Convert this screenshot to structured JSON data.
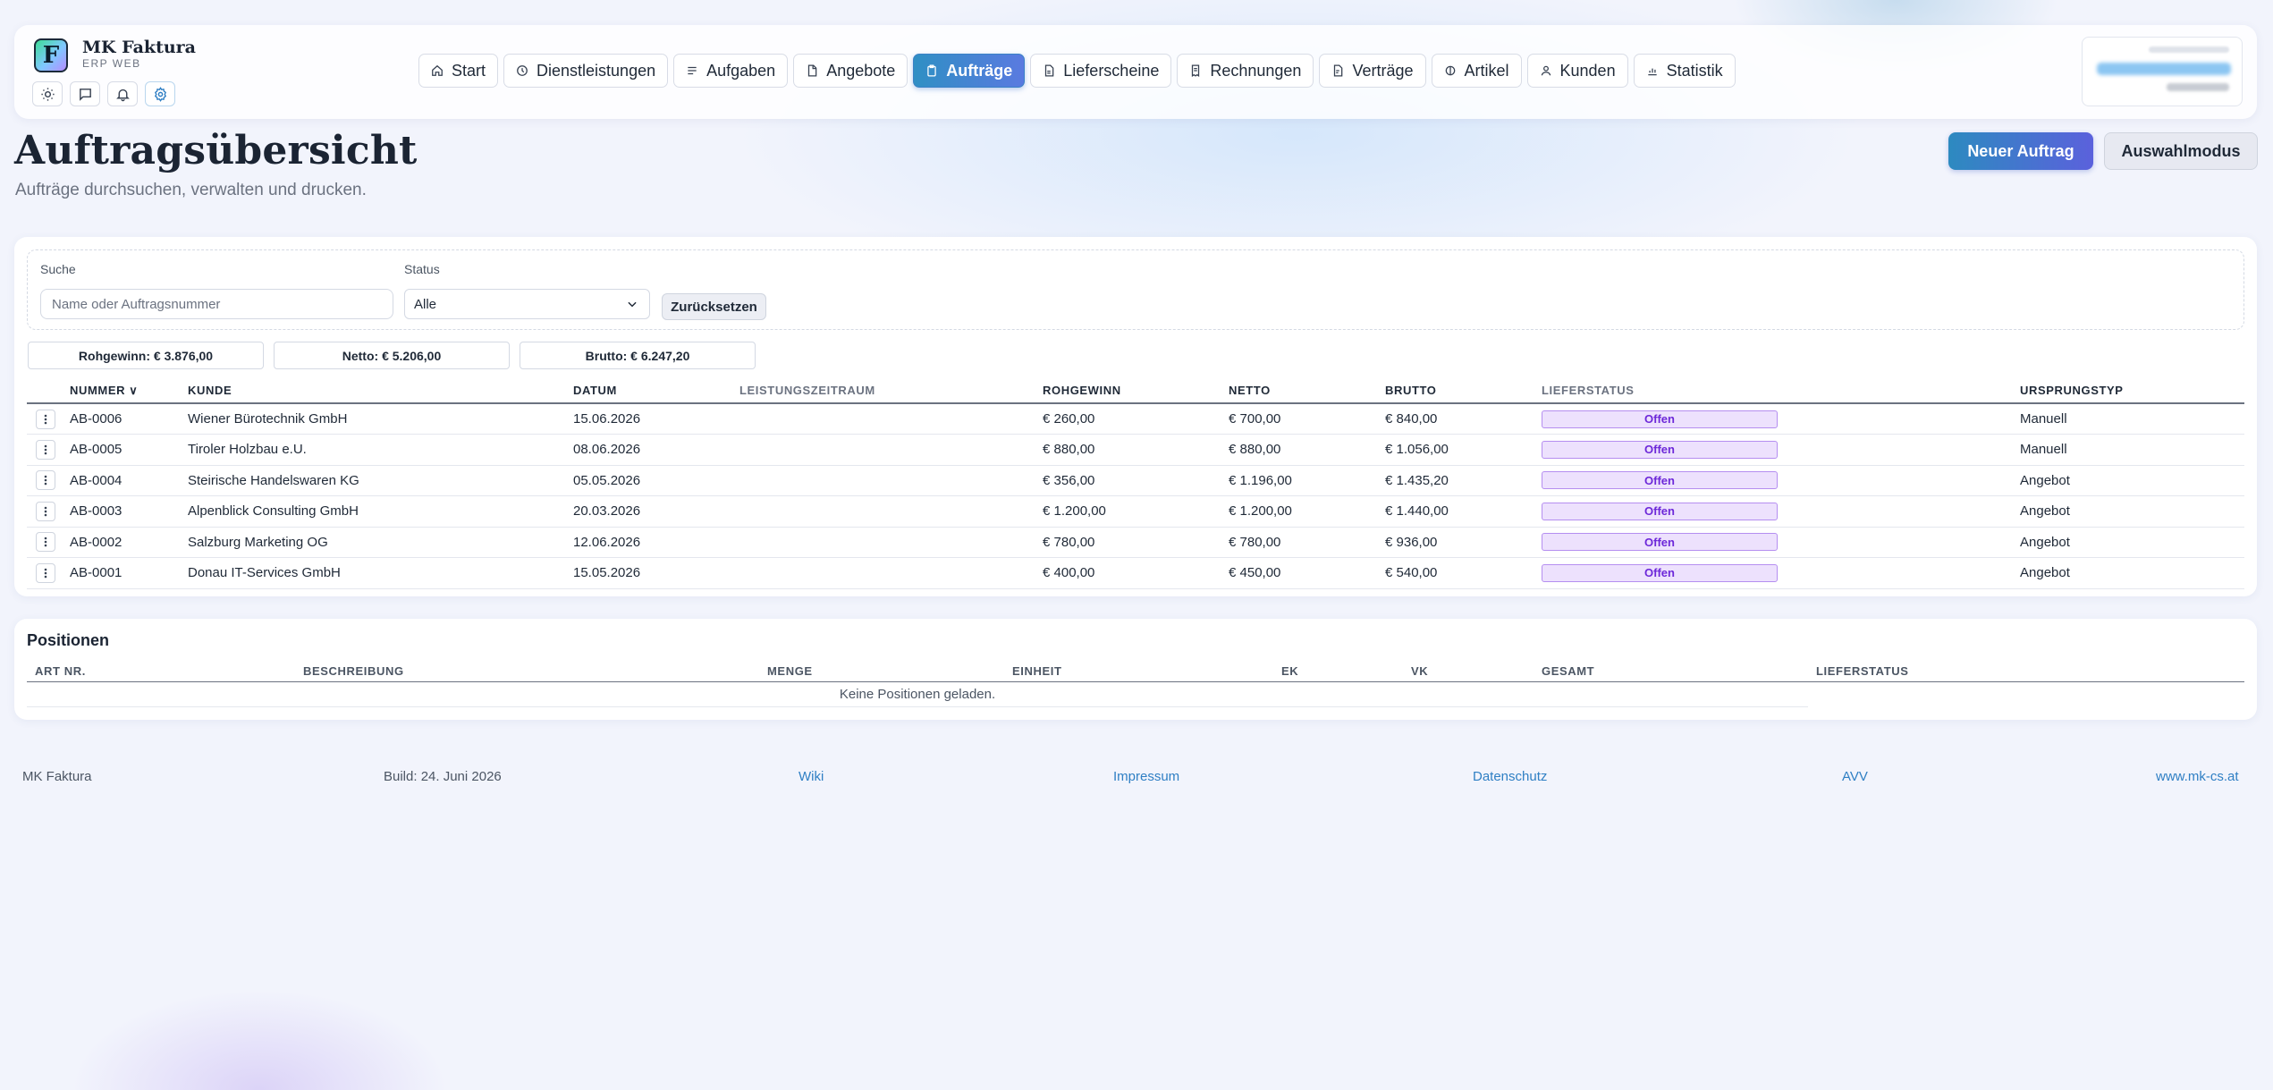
{
  "brand": {
    "logo_letter": "F",
    "name": "MK Faktura",
    "subtitle": "ERP WEB"
  },
  "utility_icons": [
    "sun-icon",
    "chat-icon",
    "bell-icon",
    "gear-icon"
  ],
  "nav": [
    {
      "label": "Start",
      "icon": "home-icon",
      "active": false
    },
    {
      "label": "Dienstleistungen",
      "icon": "clock-icon",
      "active": false
    },
    {
      "label": "Aufgaben",
      "icon": "list-icon",
      "active": false
    },
    {
      "label": "Angebote",
      "icon": "document-icon",
      "active": false
    },
    {
      "label": "Aufträge",
      "icon": "clipboard-icon",
      "active": true
    },
    {
      "label": "Lieferscheine",
      "icon": "document-icon",
      "active": false
    },
    {
      "label": "Rechnungen",
      "icon": "receipt-icon",
      "active": false
    },
    {
      "label": "Verträge",
      "icon": "document-icon",
      "active": false
    },
    {
      "label": "Artikel",
      "icon": "box-icon",
      "active": false
    },
    {
      "label": "Kunden",
      "icon": "user-icon",
      "active": false
    },
    {
      "label": "Statistik",
      "icon": "chart-icon",
      "active": false
    }
  ],
  "page": {
    "title": "Auftragsübersicht",
    "subtitle": "Aufträge durchsuchen, verwalten und drucken.",
    "new_button": "Neuer Auftrag",
    "select_button": "Auswahlmodus"
  },
  "filters": {
    "search_label": "Suche",
    "search_placeholder": "Name oder Auftragsnummer",
    "search_value": "",
    "status_label": "Status",
    "status_value": "Alle",
    "reset_button": "Zurücksetzen"
  },
  "summary": {
    "rohgewinn": "Rohgewinn: € 3.876,00",
    "netto": "Netto: € 5.206,00",
    "brutto": "Brutto: € 6.247,20"
  },
  "orders_table": {
    "columns": [
      "NUMMER ∨",
      "KUNDE",
      "DATUM",
      "LEISTUNGSZEITRAUM",
      "ROHGEWINN",
      "NETTO",
      "BRUTTO",
      "LIEFERSTATUS",
      "URSPRUNGSTYP"
    ],
    "rows": [
      {
        "nummer": "AB-0006",
        "kunde": "Wiener Bürotechnik GmbH",
        "datum": "15.06.2026",
        "zeitraum": "",
        "rohgewinn": "€ 260,00",
        "netto": "€ 700,00",
        "brutto": "€ 840,00",
        "status": "Offen",
        "typ": "Manuell"
      },
      {
        "nummer": "AB-0005",
        "kunde": "Tiroler Holzbau e.U.",
        "datum": "08.06.2026",
        "zeitraum": "",
        "rohgewinn": "€ 880,00",
        "netto": "€ 880,00",
        "brutto": "€ 1.056,00",
        "status": "Offen",
        "typ": "Manuell"
      },
      {
        "nummer": "AB-0004",
        "kunde": "Steirische Handelswaren KG",
        "datum": "05.05.2026",
        "zeitraum": "",
        "rohgewinn": "€ 356,00",
        "netto": "€ 1.196,00",
        "brutto": "€ 1.435,20",
        "status": "Offen",
        "typ": "Angebot"
      },
      {
        "nummer": "AB-0003",
        "kunde": "Alpenblick Consulting GmbH",
        "datum": "20.03.2026",
        "zeitraum": "",
        "rohgewinn": "€ 1.200,00",
        "netto": "€ 1.200,00",
        "brutto": "€ 1.440,00",
        "status": "Offen",
        "typ": "Angebot"
      },
      {
        "nummer": "AB-0002",
        "kunde": "Salzburg Marketing OG",
        "datum": "12.06.2026",
        "zeitraum": "",
        "rohgewinn": "€ 780,00",
        "netto": "€ 780,00",
        "brutto": "€ 936,00",
        "status": "Offen",
        "typ": "Angebot"
      },
      {
        "nummer": "AB-0001",
        "kunde": "Donau IT-Services GmbH",
        "datum": "15.05.2026",
        "zeitraum": "",
        "rohgewinn": "€ 400,00",
        "netto": "€ 450,00",
        "brutto": "€ 540,00",
        "status": "Offen",
        "typ": "Angebot"
      }
    ]
  },
  "positions": {
    "title": "Positionen",
    "columns": [
      "ART NR.",
      "BESCHREIBUNG",
      "MENGE",
      "EINHEIT",
      "EK",
      "VK",
      "GESAMT",
      "LIEFERSTATUS"
    ],
    "empty_text": "Keine Positionen geladen."
  },
  "footer": {
    "app": "MK Faktura",
    "build": "Build: 24. Juni 2026",
    "wiki": "Wiki",
    "impressum": "Impressum",
    "datenschutz": "Datenschutz",
    "avv": "AVV",
    "website": "www.mk-cs.at"
  },
  "colors": {
    "accent_start": "#2f8fc4",
    "accent_end": "#5a7ae0",
    "badge_bg": "#ede1fd",
    "badge_text": "#6d28d9",
    "link": "#2f7fc4"
  }
}
